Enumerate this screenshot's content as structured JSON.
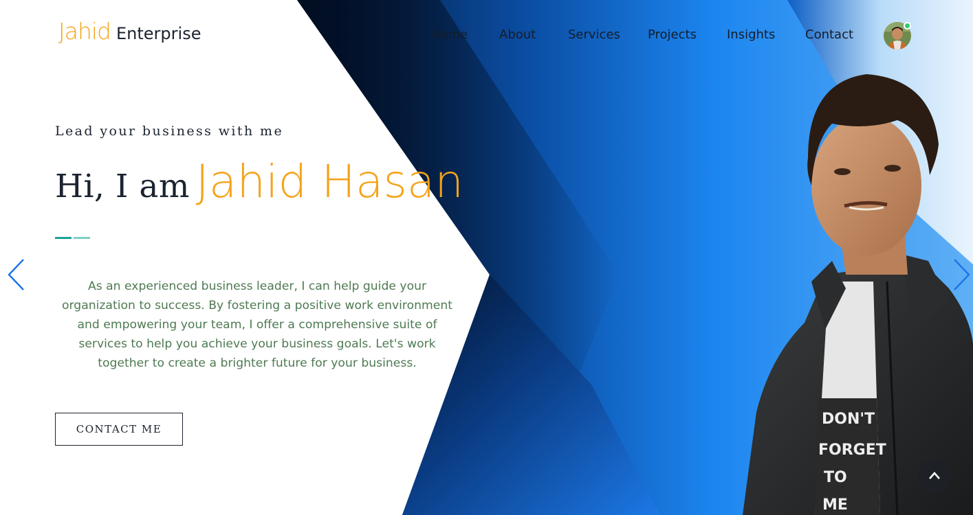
{
  "brand": {
    "name_accent": "Jahid",
    "name_rest": "Enterprise"
  },
  "nav": {
    "items": [
      "Home",
      "About",
      "Services",
      "Projects",
      "Insights",
      "Contact"
    ]
  },
  "profile": {
    "avatar_icon": "user-avatar",
    "status": "online",
    "status_color": "#2ecc71"
  },
  "hero": {
    "tagline": "Lead your business with me",
    "greeting": "Hi, I am",
    "name": "Jahid Hasan",
    "description": "As an experienced business leader, I can help guide your organization to success. By fostering a positive work environment and empowering your team, I offer a comprehensive suite of services to help you achieve your business goals. Let's work together to create a brighter future for your business.",
    "cta_label": "CONTACT ME",
    "shirt_text": [
      "DON'T",
      "FORGET",
      "TO",
      "ME"
    ]
  },
  "slider": {
    "prev_icon": "chevron-left-icon",
    "next_icon": "chevron-right-icon"
  },
  "scroll_top": {
    "icon": "chevron-up-icon"
  },
  "colors": {
    "accent": "#f5a31a",
    "dark_text": "#1b2330",
    "description_text": "#4e7a52",
    "blue_gradient_light": "#2a8cf0",
    "blue_gradient_dark": "#041a3a",
    "arrow_blue": "#1a73e8",
    "divider_primary": "#1aa39a",
    "divider_secondary": "#7fcfc8"
  }
}
